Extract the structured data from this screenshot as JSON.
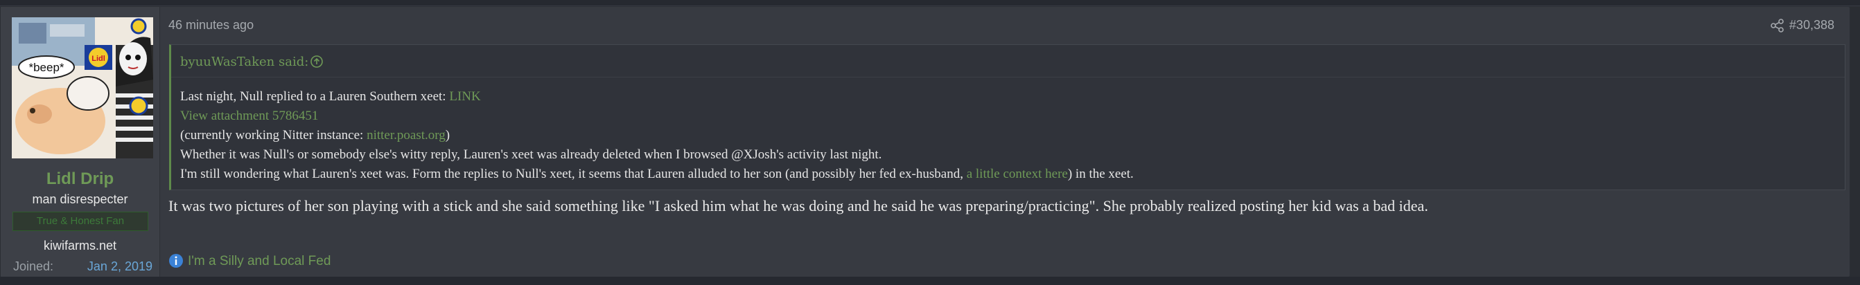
{
  "post": {
    "time": "46 minutes ago",
    "number": "#30,388"
  },
  "user": {
    "name": "Lidl Drip",
    "title": "man disrespecter",
    "banner": "True & Honest Fan",
    "site": "kiwifarms.net",
    "joined_label": "Joined:",
    "joined_date": "Jan 2, 2019",
    "avatar_caption": "*beep*",
    "avatar_logo_text": "Lidl"
  },
  "quote": {
    "author": "byuuWasTaken said:",
    "line1_text": "Last night, Null replied to a Lauren Southern xeet: ",
    "line1_link": "LINK",
    "line2_link": "View attachment 5786451",
    "line3_prefix": "(currently working Nitter instance: ",
    "line3_link": "nitter.poast.org",
    "line3_suffix": ")",
    "line4": "Whether it was Null's or somebody else's witty reply, Lauren's xeet was already deleted when I browsed @XJosh's activity last night.",
    "line5_prefix": "I'm still wondering what Lauren's xeet was. Form the replies to Null's xeet, it seems that Lauren alluded to her son (and possibly her fed ex-husband, ",
    "line5_link": "a little context here",
    "line5_suffix": ") in the xeet."
  },
  "reply": "It was two pictures of her son playing with a stick and she said something like \"I asked him what he was doing and he said he was preparing/practicing\". She probably realized posting her kid was a bad idea.",
  "signature": "I'm a Silly and Local Fed",
  "colors": {
    "accent_green": "#6f9a57",
    "link_blue": "#6aa7d8",
    "info_icon_blue": "#3b82d6"
  },
  "icons": {
    "share": "share-icon",
    "quote_jump": "arrow-up-circle-icon",
    "info": "info-icon"
  }
}
